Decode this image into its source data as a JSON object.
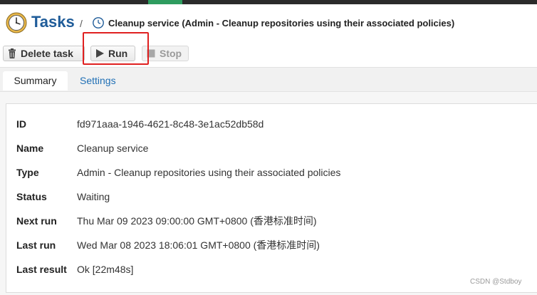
{
  "header": {
    "app_title": "Tasks",
    "separator": "/",
    "task_title": "Cleanup service (Admin - Cleanup repositories using their associated policies)"
  },
  "toolbar": {
    "delete_label": "Delete task",
    "run_label": "Run",
    "stop_label": "Stop"
  },
  "tabs": [
    {
      "label": "Summary",
      "active": true
    },
    {
      "label": "Settings",
      "active": false
    }
  ],
  "summary": {
    "rows": [
      {
        "key": "ID",
        "value": "fd971aaa-1946-4621-8c48-3e1ac52db58d"
      },
      {
        "key": "Name",
        "value": "Cleanup service"
      },
      {
        "key": "Type",
        "value": "Admin - Cleanup repositories using their associated policies"
      },
      {
        "key": "Status",
        "value": "Waiting"
      },
      {
        "key": "Next run",
        "value": "Thu Mar 09 2023 09:00:00 GMT+0800 (香港标准时间)"
      },
      {
        "key": "Last run",
        "value": "Wed Mar 08 2023 18:06:01 GMT+0800 (香港标准时间)"
      },
      {
        "key": "Last result",
        "value": "Ok [22m48s]"
      }
    ]
  },
  "watermark": "CSDN @Stdboy",
  "colors": {
    "title_blue": "#1f5c99",
    "link_blue": "#1f6fb5",
    "highlight_red": "#e02020",
    "top_accent_green": "#2e9c5f"
  },
  "icons": {
    "app": "clock-icon",
    "task": "clock-icon",
    "delete": "trash-icon",
    "run": "play-icon",
    "stop": "stop-icon"
  }
}
